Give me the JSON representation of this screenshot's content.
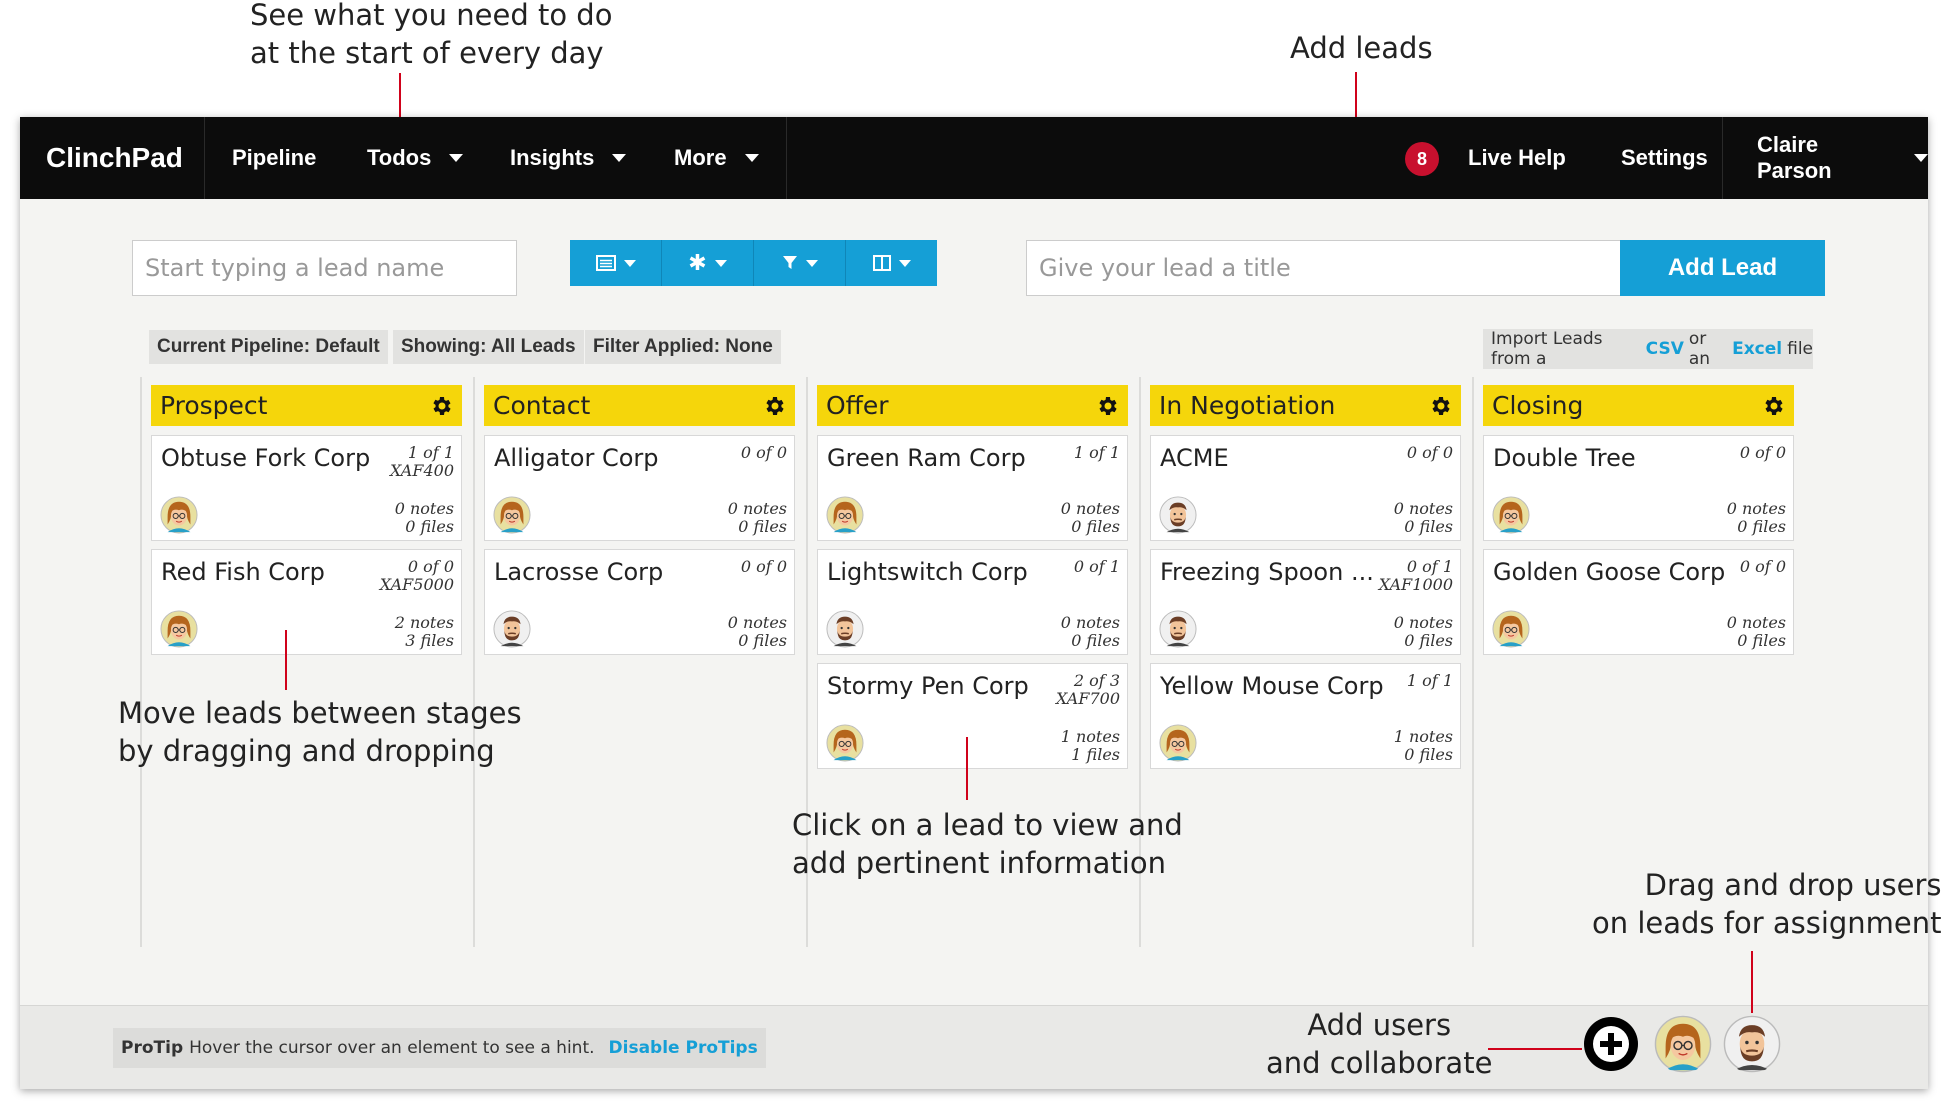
{
  "annotations": {
    "todos": [
      "See what you need to do",
      "at the start of every day"
    ],
    "add_leads": "Add leads",
    "move_leads": [
      "Move leads between stages",
      "by dragging and dropping"
    ],
    "click_lead": [
      "Click on a lead to view and",
      "add pertinent information"
    ],
    "drag_users": [
      "Drag and drop users",
      "on leads for assignment"
    ],
    "add_users": [
      "Add users",
      "and collaborate"
    ],
    "line_color": "#d0021b"
  },
  "nav": {
    "brand": "ClinchPad",
    "items": [
      {
        "label": "Pipeline"
      },
      {
        "label": "Todos"
      },
      {
        "label": "Insights"
      },
      {
        "label": "More"
      }
    ],
    "notification_count": "8",
    "live_help": "Live Help",
    "settings": "Settings",
    "user": "Claire Parson"
  },
  "toolbar": {
    "search_placeholder": "Start typing a lead name",
    "title_placeholder": "Give your lead a title",
    "add_lead": "Add Lead",
    "view_buttons": [
      "list-view-icon",
      "settings-star-icon",
      "filter-icon",
      "columns-icon"
    ]
  },
  "chips": {
    "pipeline": "Current Pipeline: Default",
    "showing": "Showing: All Leads",
    "filter": "Filter Applied: None"
  },
  "import": {
    "prefix": "Import Leads from a",
    "csv": "CSV",
    "or": "or an",
    "excel": "Excel",
    "suffix": "file"
  },
  "stages": [
    {
      "name": "Prospect",
      "cards": [
        {
          "name": "Obtuse Fork Corp",
          "count": "1 of 1",
          "code": "XAF400",
          "notes": "0 notes",
          "files": "0 files",
          "avatar": "woman"
        },
        {
          "name": "Red Fish Corp",
          "count": "0 of 0",
          "code": "XAF5000",
          "notes": "2 notes",
          "files": "3 files",
          "avatar": "woman"
        }
      ]
    },
    {
      "name": "Contact",
      "cards": [
        {
          "name": "Alligator Corp",
          "count": "0 of 0",
          "code": "",
          "notes": "0 notes",
          "files": "0 files",
          "avatar": "woman"
        },
        {
          "name": "Lacrosse Corp",
          "count": "0 of 0",
          "code": "",
          "notes": "0 notes",
          "files": "0 files",
          "avatar": "man"
        }
      ]
    },
    {
      "name": "Offer",
      "cards": [
        {
          "name": "Green Ram Corp",
          "count": "1 of 1",
          "code": "",
          "notes": "0 notes",
          "files": "0 files",
          "avatar": "woman"
        },
        {
          "name": "Lightswitch Corp",
          "count": "0 of 1",
          "code": "",
          "notes": "0 notes",
          "files": "0 files",
          "avatar": "man"
        },
        {
          "name": "Stormy Pen Corp",
          "count": "2 of 3",
          "code": "XAF700",
          "notes": "1 notes",
          "files": "1 files",
          "avatar": "woman"
        }
      ]
    },
    {
      "name": "In Negotiation",
      "cards": [
        {
          "name": "ACME",
          "count": "0 of 0",
          "code": "",
          "notes": "0 notes",
          "files": "0 files",
          "avatar": "man"
        },
        {
          "name": "Freezing Spoon ...",
          "count": "0 of 1",
          "code": "XAF1000",
          "notes": "0 notes",
          "files": "0 files",
          "avatar": "man"
        },
        {
          "name": "Yellow Mouse Corp",
          "count": "1 of 1",
          "code": "",
          "notes": "1 notes",
          "files": "0 files",
          "avatar": "woman"
        }
      ]
    },
    {
      "name": "Closing",
      "cards": [
        {
          "name": "Double Tree",
          "count": "0 of 0",
          "code": "",
          "notes": "0 notes",
          "files": "0 files",
          "avatar": "woman"
        },
        {
          "name": "Golden Goose Corp",
          "count": "0 of 0",
          "code": "",
          "notes": "0 notes",
          "files": "0 files",
          "avatar": "woman"
        }
      ]
    }
  ],
  "footer": {
    "protip_label": "ProTip",
    "protip_text": "Hover the cursor over an element to see a hint.",
    "disable": "Disable ProTips"
  },
  "colors": {
    "accent": "#159fd6",
    "stage_header": "#f5d60b",
    "navbar": "#0c0c0c",
    "badge": "#c8102e"
  }
}
